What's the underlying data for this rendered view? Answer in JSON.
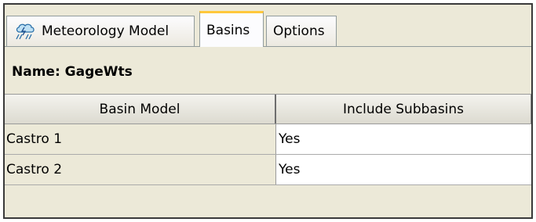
{
  "tabs": [
    {
      "label": "Meteorology Model",
      "icon": "meteorology-icon",
      "active": false
    },
    {
      "label": "Basins",
      "active": true
    },
    {
      "label": "Options",
      "active": false
    }
  ],
  "panel": {
    "name_label": "Name: GageWts"
  },
  "table": {
    "columns": [
      "Basin Model",
      "Include Subbasins"
    ],
    "rows": [
      [
        "Castro 1",
        "Yes"
      ],
      [
        "Castro 2",
        "Yes"
      ]
    ]
  },
  "colors": {
    "active_tab_accent": "#ffc83c",
    "panel_background": "#ece9d8"
  }
}
